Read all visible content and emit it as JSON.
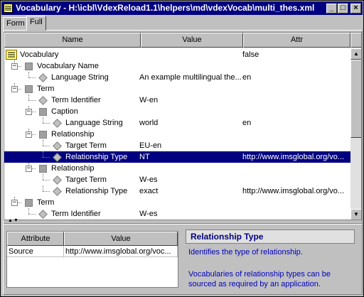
{
  "window": {
    "title": "Vocabulary - H:\\icbl\\VdexReload1.1\\helpers\\md\\vdexVocab\\multi_thes.xml",
    "minimize": "_",
    "maximize": "□",
    "close": "×"
  },
  "tabs": [
    "Form",
    "Full"
  ],
  "columns": [
    "Name",
    "Value",
    "Attr"
  ],
  "rows": [
    {
      "name": "Vocabulary",
      "value": "",
      "attr": "false",
      "depth": 0,
      "icon": "vocab-icon"
    },
    {
      "name": "Vocabulary Name",
      "value": "",
      "attr": "",
      "depth": 1,
      "icon": "node-box"
    },
    {
      "name": "Language String",
      "value": "An example multilingual the...",
      "attr": "en",
      "depth": 2,
      "icon": "node-diamond"
    },
    {
      "name": "Term",
      "value": "",
      "attr": "",
      "depth": 1,
      "icon": "node-box"
    },
    {
      "name": "Term Identifier",
      "value": "W-en",
      "attr": "",
      "depth": 2,
      "icon": "node-diamond"
    },
    {
      "name": "Caption",
      "value": "",
      "attr": "",
      "depth": 2,
      "icon": "node-box"
    },
    {
      "name": "Language String",
      "value": "world",
      "attr": "en",
      "depth": 3,
      "icon": "node-diamond"
    },
    {
      "name": "Relationship",
      "value": "",
      "attr": "",
      "depth": 2,
      "icon": "node-box"
    },
    {
      "name": "Target Term",
      "value": "EU-en",
      "attr": "",
      "depth": 3,
      "icon": "node-diamond"
    },
    {
      "name": "Relationship Type",
      "value": "NT",
      "attr": "http://www.imsglobal.org/vo...",
      "depth": 3,
      "icon": "node-diamond",
      "selected": true
    },
    {
      "name": "Relationship",
      "value": "",
      "attr": "",
      "depth": 2,
      "icon": "node-box"
    },
    {
      "name": "Target Term",
      "value": "W-es",
      "attr": "",
      "depth": 3,
      "icon": "node-diamond"
    },
    {
      "name": "Relationship Type",
      "value": "exact",
      "attr": "http://www.imsglobal.org/vo...",
      "depth": 3,
      "icon": "node-diamond"
    },
    {
      "name": "Term",
      "value": "",
      "attr": "",
      "depth": 1,
      "icon": "node-box"
    },
    {
      "name": "Term Identifier",
      "value": "W-es",
      "attr": "",
      "depth": 2,
      "icon": "node-diamond"
    }
  ],
  "attributes": {
    "columns": [
      "Attribute",
      "Value"
    ],
    "rows": [
      {
        "attribute": "Source",
        "value": "http://www.imsglobal.org/voc..."
      }
    ]
  },
  "help": {
    "title": "Relationship Type",
    "lines": [
      "Identifies the type of relationship.",
      "",
      "Vocabularies of relationship types can be",
      "sourced as required by an application."
    ]
  },
  "colors": {
    "titlebar": "#000080",
    "selection": "#000080",
    "help_text": "#0000c0"
  }
}
